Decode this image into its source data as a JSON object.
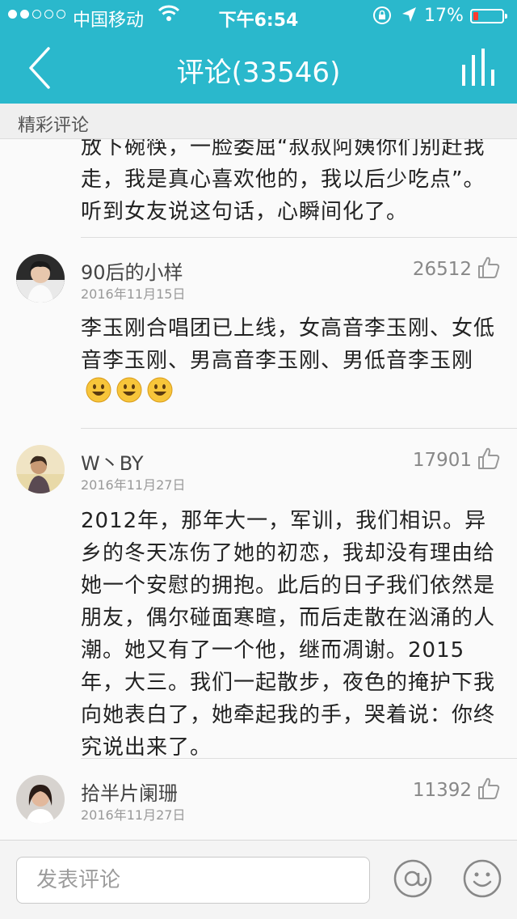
{
  "status_bar": {
    "carrier": "中国移动",
    "time": "下午6:54",
    "battery_text": "17%",
    "battery_level": 0.17,
    "signal_dots_filled": 2,
    "signal_dots_total": 5
  },
  "nav": {
    "title": "评论(33546)"
  },
  "section": {
    "title": "精彩评论"
  },
  "partial_comment": {
    "text": "放下碗筷，一脸委屈“叔叔阿姨你们别赶我走，我是真心喜欢他的，我以后少吃点”。听到女友说这句话，心瞬间化了。"
  },
  "comments": [
    {
      "name": "90后的小样",
      "date": "2016年11月15日",
      "likes": "26512",
      "text": "李玉刚合唱团已上线，女高音李玉刚、女低音李玉刚、男高音李玉刚、男低音李玉刚"
    },
    {
      "name": "W丶BY",
      "date": "2016年11月27日",
      "likes": "17901",
      "text": "2012年，那年大一，军训，我们相识。异乡的冬天冻伤了她的初恋，我却没有理由给她一个安慰的拥抱。此后的日子我们依然是朋友，偶尔碰面寒暄，而后走散在汹涌的人潮。她又有了一个他，继而凋谢。2015年，大三。我们一起散步，夜色的掩护下我向她表白了，她牵起我的手，哭着说：你终究说出来了。"
    },
    {
      "name": "拾半片阑珊",
      "date": "2016年11月27日",
      "likes": "11392"
    }
  ],
  "input": {
    "placeholder": "发表评论"
  },
  "colors": {
    "header": "#2ab8cc",
    "battery_low": "#ff3b30"
  },
  "icons": [
    "back-icon",
    "stats-icon",
    "thumb-up-icon",
    "smile-emoji-icon",
    "at-icon",
    "emoji-icon",
    "wifi-icon",
    "lock-rotation-icon",
    "location-icon",
    "battery-icon"
  ]
}
